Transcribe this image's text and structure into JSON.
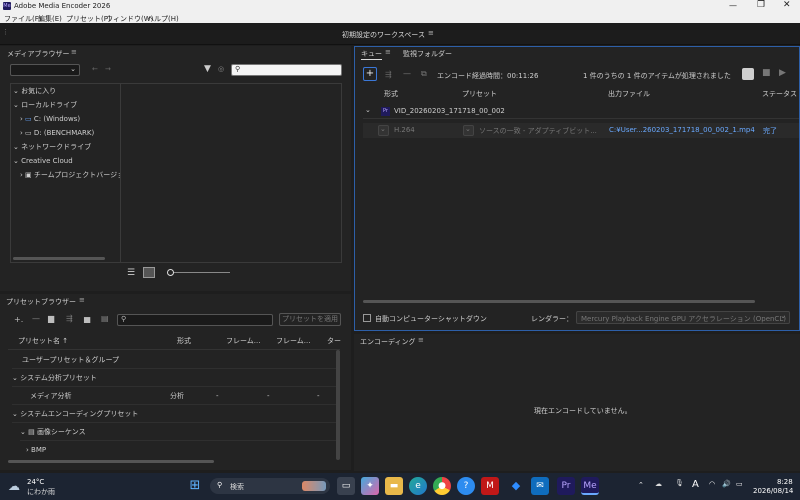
{
  "window": {
    "title": "Adobe Media Encoder 2026",
    "app_icon": "Me",
    "controls": [
      "minimize-icon",
      "maximize-icon",
      "close-icon"
    ]
  },
  "menu": {
    "items": [
      "ファイル(F)",
      "編集(E)",
      "プリセット(P)",
      "ウィンドウ(W)",
      "ヘルプ(H)"
    ]
  },
  "workspace": {
    "title": "初期設定のワークスペース"
  },
  "media_browser": {
    "title": "メディアブラウザー",
    "tree": [
      {
        "label": "お気に入り",
        "level": 0,
        "expanded": true
      },
      {
        "label": "ローカルドライブ",
        "level": 0,
        "expanded": true
      },
      {
        "label": "C: (Windows)",
        "level": 1,
        "expanded": false
      },
      {
        "label": "D: (BENCHMARK)",
        "level": 1,
        "expanded": false
      },
      {
        "label": "ネットワークドライブ",
        "level": 0,
        "expanded": true
      },
      {
        "label": "Creative Cloud",
        "level": 0,
        "expanded": true
      },
      {
        "label": "チームプロジェクトバージョン",
        "level": 1,
        "expanded": false
      }
    ]
  },
  "queue": {
    "tabs": [
      "キュー",
      "監視フォルダー"
    ],
    "elapsed": "エンコード経過時間：00:11:26",
    "status": "1 件のうちの 1 件のアイテムが処理されました",
    "columns": [
      "形式",
      "プリセット",
      "出力ファイル",
      "ステータス"
    ],
    "item": {
      "name": "VID_20260203_171718_00_002",
      "badge": "Pr",
      "format": "H.264",
      "preset": "ソースの一致 - アダプティブビット...",
      "output": "C:¥User...260203_171718_00_002_1.mp4",
      "status": "完了"
    },
    "shutdown_label": "自動コンピューターシャットダウン",
    "renderer_label": "レンダラー：",
    "renderer_value": "Mercury Playback Engine GPU アクセラレーション (OpenCL)"
  },
  "preset_browser": {
    "title": "プリセットブラウザー",
    "apply_label": "プリセットを適用",
    "columns": [
      "プリセット名 ↑",
      "形式",
      "フレーム...",
      "フレーム...",
      "ター"
    ],
    "rows": [
      {
        "label": "ユーザープリセット＆グループ",
        "level": 0,
        "chevron": "",
        "format": "",
        "c1": "",
        "c2": "",
        "c3": ""
      },
      {
        "label": "システム分析プリセット",
        "level": 0,
        "chevron": "v",
        "format": "",
        "c1": "",
        "c2": "",
        "c3": ""
      },
      {
        "label": "メディア分析",
        "level": 1,
        "chevron": "",
        "format": "分析",
        "c1": "-",
        "c2": "-",
        "c3": "-"
      },
      {
        "label": "システムエンコーディングプリセット",
        "level": 0,
        "chevron": "v",
        "format": "",
        "c1": "",
        "c2": "",
        "c3": ""
      },
      {
        "label": "画像シーケンス",
        "level": 1,
        "chevron": "v",
        "format": "",
        "c1": "",
        "c2": "",
        "c3": ""
      },
      {
        "label": "BMP",
        "level": 2,
        "chevron": ">",
        "format": "",
        "c1": "",
        "c2": "",
        "c3": ""
      }
    ]
  },
  "encoding": {
    "title": "エンコーディング",
    "empty": "現在エンコードしていません。"
  },
  "taskbar": {
    "weather_temp": "24°C",
    "weather_desc": "にわか雨",
    "search_placeholder": "検索",
    "time": "8:28",
    "date": "2026/08/14",
    "ime": "A"
  },
  "colors": {
    "accent": "#3b78d8",
    "done_blue": "#6aa9ff",
    "panel": "#232323",
    "background": "#1e1e1e"
  }
}
